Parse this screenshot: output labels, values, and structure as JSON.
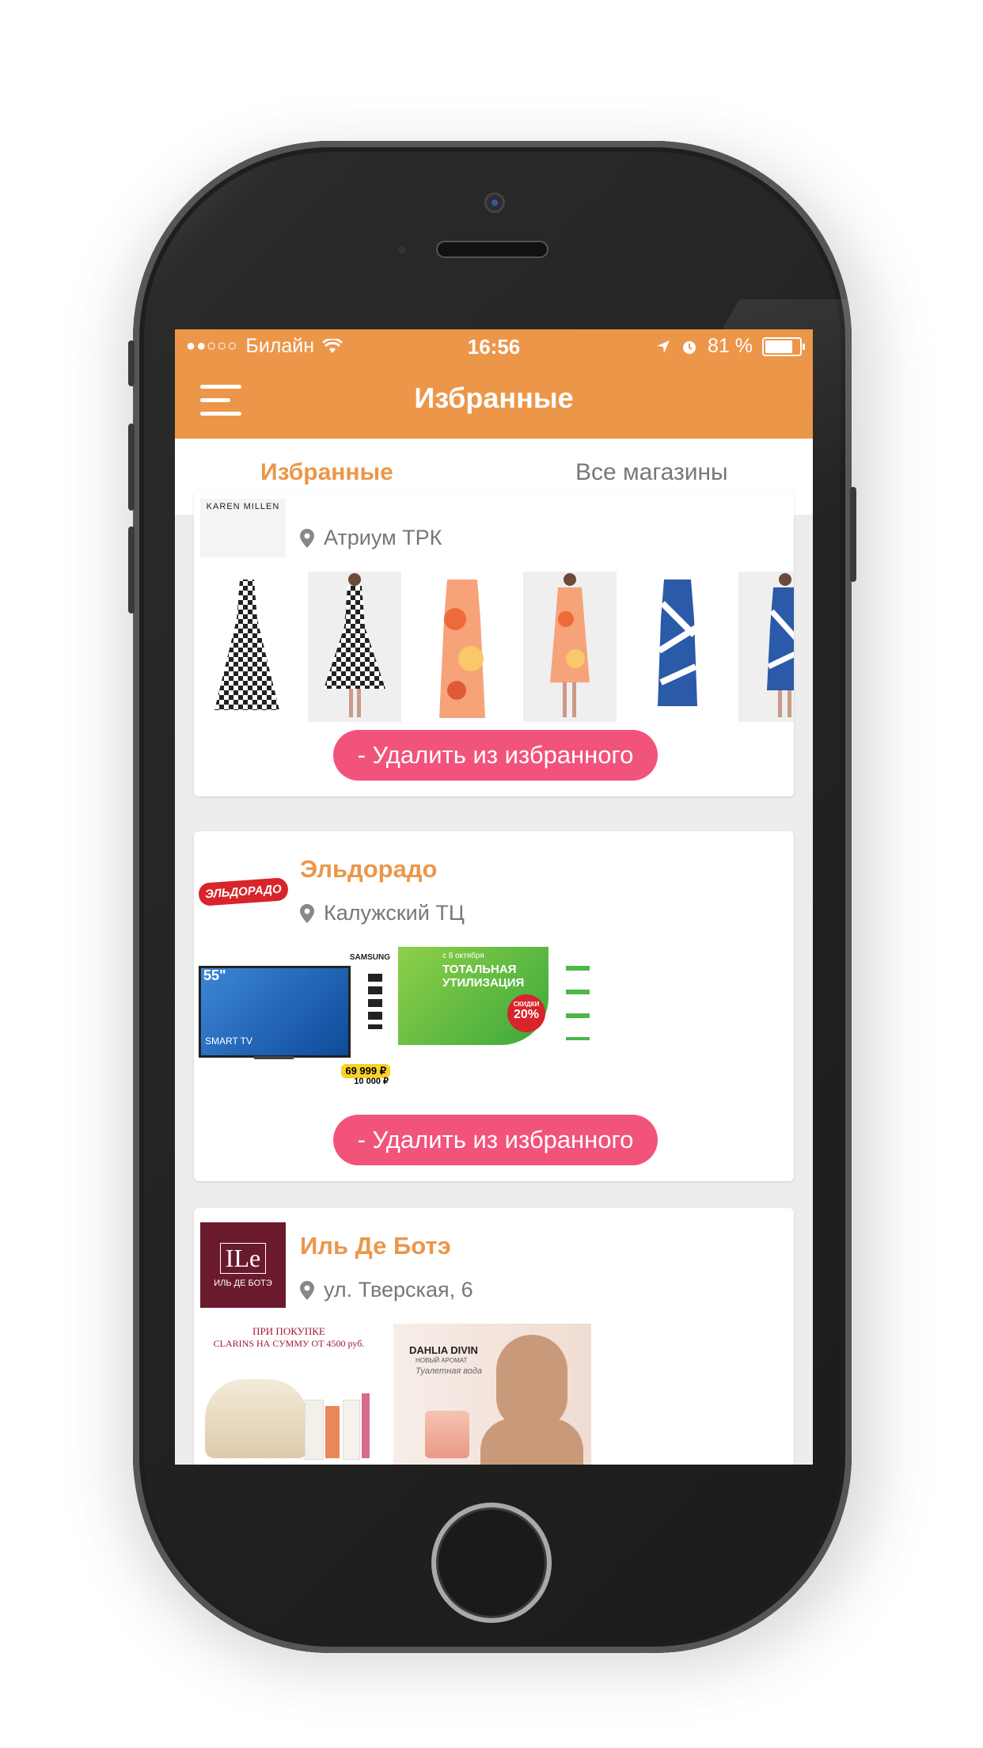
{
  "status_bar": {
    "signal": "●●○○○",
    "carrier": "Билайн",
    "time": "16:56",
    "battery": "81 %",
    "battery_level": 0.81
  },
  "nav": {
    "title": "Избранные"
  },
  "tabs": [
    {
      "label": "Избранные",
      "active": true
    },
    {
      "label": "Все магазины",
      "active": false
    }
  ],
  "cards": [
    {
      "name": "KAREN MILLEN",
      "location": "Атриум ТРК",
      "remove_label": "- Удалить из избранного"
    },
    {
      "name": "Эльдорадо",
      "logo_text": "ЭЛЬДОРАДО",
      "location": "Калужский ТЦ",
      "promo": {
        "brand": "SAMSUNG",
        "tv_size": "55\"",
        "smart": "SMART TV",
        "price": "69 999 ₽",
        "discount_amount": "10 000 ₽",
        "banner_date": "с 8 октября",
        "banner_title": "ТОТАЛЬНАЯ УТИЛИЗАЦИЯ",
        "banner_badge_top": "СКИДКИ",
        "banner_badge": "20%"
      },
      "remove_label": "- Удалить из избранного"
    },
    {
      "name": "Иль Де Ботэ",
      "logo_text": "ИЛЬ ДЕ БОТЭ",
      "logo_mark": "ILe",
      "location": "ул. Тверская,  6",
      "promo": {
        "clarins_line1": "ПРИ ПОКУПКЕ",
        "clarins_line2": "CLARINS НА СУММУ ОТ 4500 руб.",
        "dahlia_title": "DAHLIA DIVIN",
        "dahlia_sub": "НОВЫЙ АРОМАТ",
        "dahlia_script": "Туалетная вода"
      }
    }
  ],
  "colors": {
    "accent": "#ec964a",
    "remove_button": "#f2537a",
    "eldorado_red": "#d8242b",
    "ile_burgundy": "#6b1a2e"
  }
}
